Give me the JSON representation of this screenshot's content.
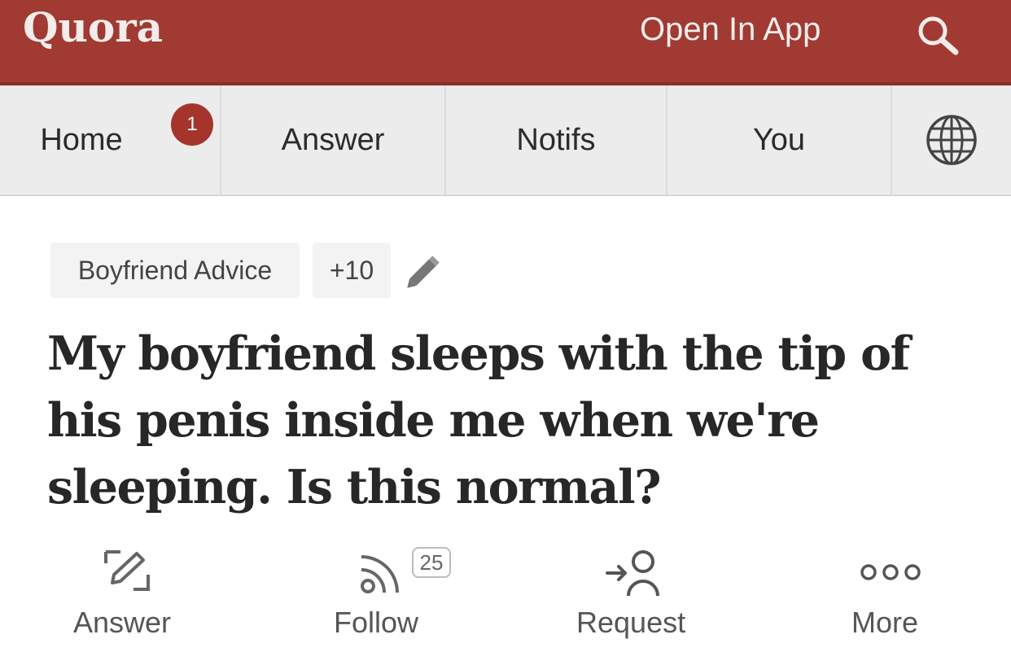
{
  "header": {
    "logo": "Quora",
    "open_in_app": "Open In App",
    "search_icon": "search-icon",
    "brand_color": "#a03a32"
  },
  "nav": {
    "items": [
      {
        "label": "Home",
        "badge": "1"
      },
      {
        "label": "Answer"
      },
      {
        "label": "Notifs"
      },
      {
        "label": "You"
      }
    ],
    "globe_icon": "globe-icon"
  },
  "topics": {
    "primary": "Boyfriend Advice",
    "more": "+10",
    "edit_icon": "pencil-icon"
  },
  "question": {
    "title": "My boyfriend sleeps with the tip of his penis inside me when we're sleeping. Is this normal?"
  },
  "actions": {
    "answer": {
      "label": "Answer",
      "icon": "answer-edit-icon"
    },
    "follow": {
      "label": "Follow",
      "count": "25",
      "icon": "follow-rss-icon"
    },
    "request": {
      "label": "Request",
      "icon": "request-user-icon"
    },
    "more": {
      "label": "More",
      "icon": "more-dots-icon"
    }
  }
}
